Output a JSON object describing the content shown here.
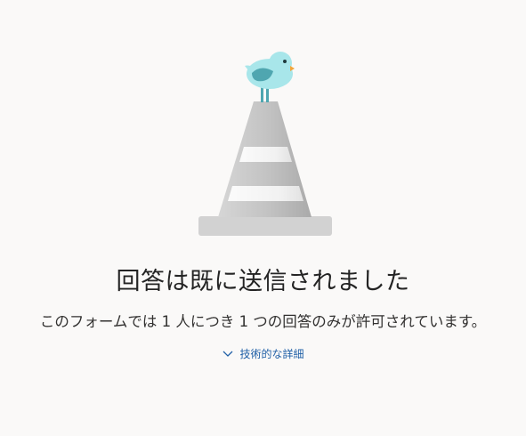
{
  "message": {
    "title": "回答は既に送信されました",
    "subtitle": "このフォームでは 1 人につき 1 つの回答のみが許可されています。"
  },
  "details_toggle": {
    "label": "技術的な詳細",
    "icon": "chevron-down-icon"
  },
  "illustration": {
    "name": "bird-on-traffic-cone",
    "colors": {
      "bird_body": "#a8e6ea",
      "bird_wing": "#4fa6b0",
      "bird_beak": "#f2a63b",
      "cone_gray": "#c4c4c4",
      "cone_stripe": "#f4f4f4",
      "base_gray": "#d2d2d2"
    }
  },
  "colors": {
    "background": "#faf9f8",
    "title_text": "#242424",
    "body_text": "#323130",
    "link": "#1f5fa6"
  }
}
